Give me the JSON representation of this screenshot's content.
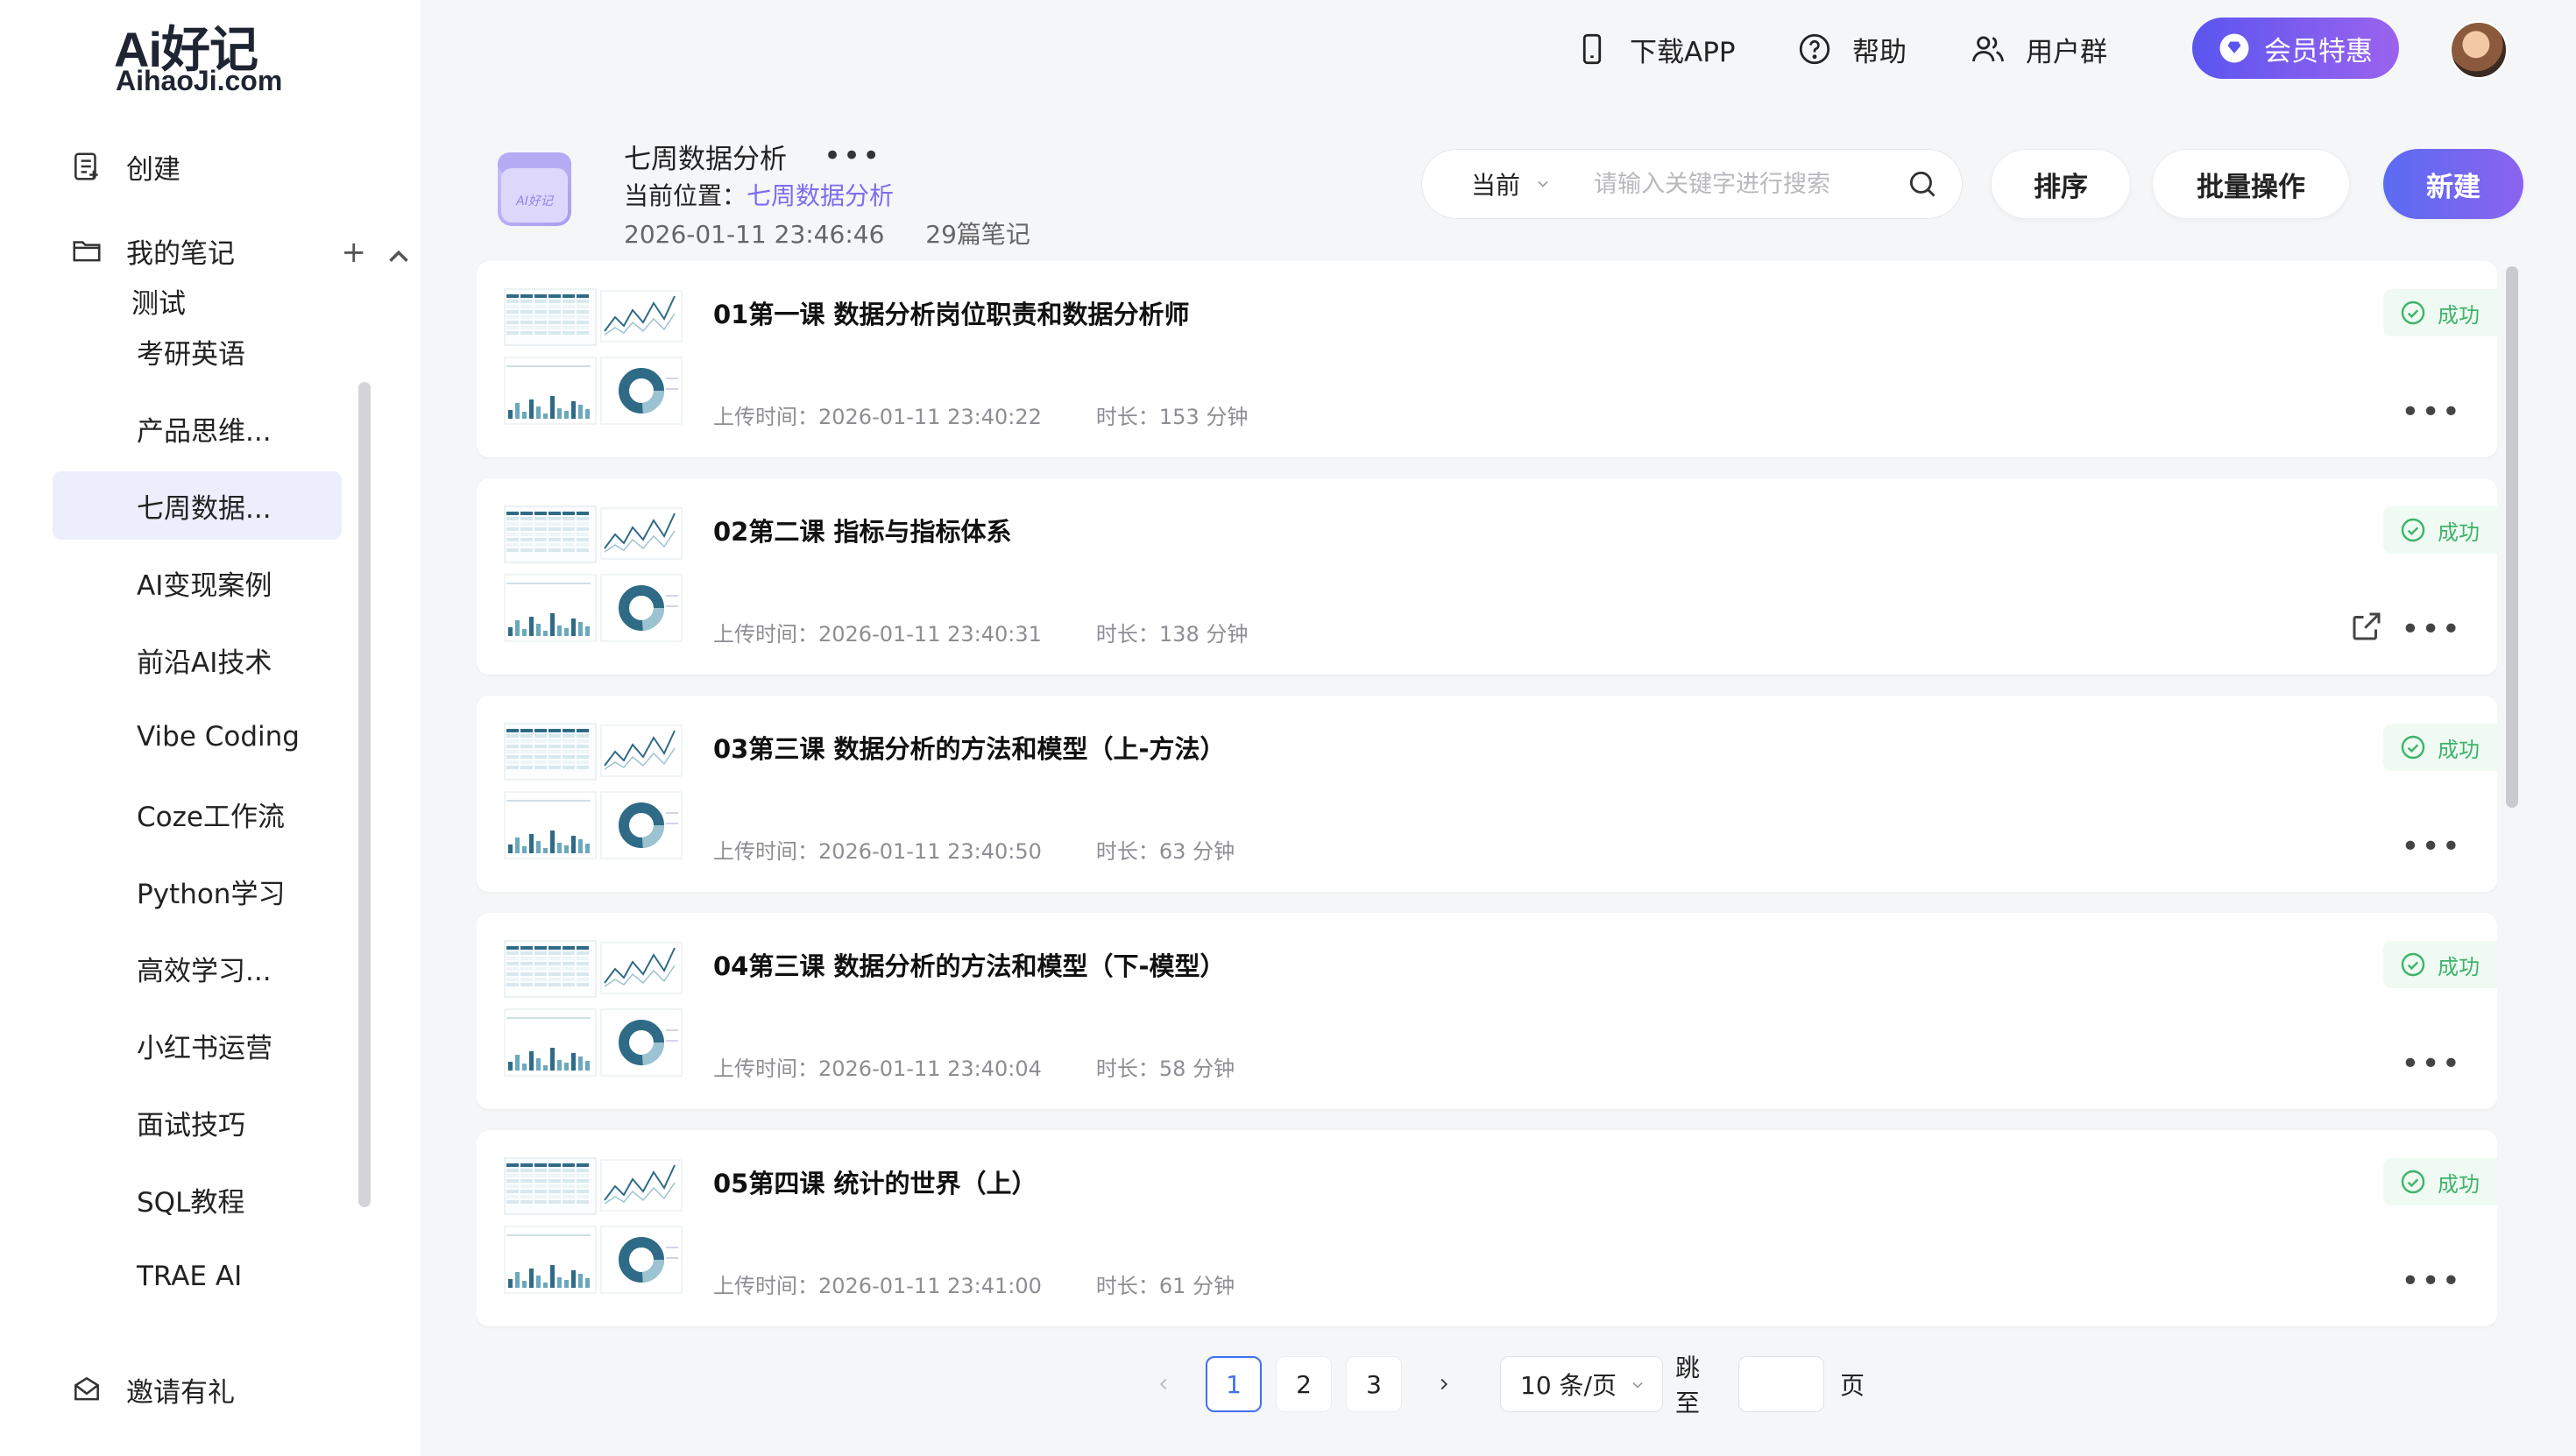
{
  "logo": {
    "main": "Ai好记",
    "sub": "AihaoJi.com"
  },
  "sidebar": {
    "create": "创建",
    "my_notes": "我的笔记",
    "items": [
      {
        "label": "测试"
      },
      {
        "label": "考研英语"
      },
      {
        "label": "产品思维..."
      },
      {
        "label": "七周数据..."
      },
      {
        "label": "AI变现案例"
      },
      {
        "label": "前沿AI技术"
      },
      {
        "label": "Vibe Coding"
      },
      {
        "label": "Coze工作流"
      },
      {
        "label": "Python学习"
      },
      {
        "label": "高效学习..."
      },
      {
        "label": "小红书运营"
      },
      {
        "label": "面试技巧"
      },
      {
        "label": "SQL教程"
      },
      {
        "label": "TRAE AI"
      }
    ],
    "active_index": 3,
    "invite": "邀请有礼"
  },
  "topbar": {
    "download": "下载APP",
    "help": "帮助",
    "group": "用户群",
    "vip": "会员特惠"
  },
  "folder": {
    "title": "七周数据分析",
    "location_label": "当前位置：",
    "location_link": "七周数据分析",
    "timestamp": "2026-01-11 23:46:46",
    "count": "29篇笔记"
  },
  "search": {
    "scope": "当前",
    "placeholder": "请输入关键字进行搜索"
  },
  "buttons": {
    "sort": "排序",
    "batch": "批量操作",
    "new": "新建"
  },
  "notes": [
    {
      "title": "01第一课 数据分析岗位职责和数据分析师",
      "upload": "上传时间：2026-01-11 23:40:22",
      "duration": "时长：153 分钟",
      "status": "成功",
      "share": false
    },
    {
      "title": "02第二课 指标与指标体系",
      "upload": "上传时间：2026-01-11 23:40:31",
      "duration": "时长：138 分钟",
      "status": "成功",
      "share": true
    },
    {
      "title": "03第三课 数据分析的方法和模型（上-方法）",
      "upload": "上传时间：2026-01-11 23:40:50",
      "duration": "时长：63 分钟",
      "status": "成功",
      "share": false
    },
    {
      "title": "04第三课 数据分析的方法和模型（下-模型）",
      "upload": "上传时间：2026-01-11 23:40:04",
      "duration": "时长：58 分钟",
      "status": "成功",
      "share": false
    },
    {
      "title": "05第四课 统计的世界（上）",
      "upload": "上传时间：2026-01-11 23:41:00",
      "duration": "时长：61 分钟",
      "status": "成功",
      "share": false
    }
  ],
  "pagination": {
    "pages": [
      "1",
      "2",
      "3"
    ],
    "current": "1",
    "page_size": "10 条/页",
    "jump_label": "跳至",
    "page_suffix": "页"
  },
  "colors": {
    "accent": "#5b55f0",
    "link": "#7a6df0",
    "success": "#3fb36a",
    "active_bg": "#eceefc"
  }
}
